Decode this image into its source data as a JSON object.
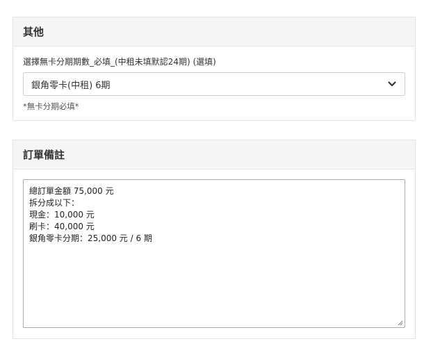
{
  "other_section": {
    "title": "其他",
    "installment_label": "選擇無卡分期期數_必填_(中租未填默認24期) (選填)",
    "installment_selected": "銀角零卡(中租) 6期",
    "help_text": "*無卡分期必填*"
  },
  "notes_section": {
    "title": "訂單備註",
    "lines": [
      "總訂單金額 75,000 元",
      "拆分成以下：",
      "現金：10,000 元",
      "刷卡：40,000 元",
      "銀角零卡分期：25,000 元 / 6 期"
    ]
  },
  "icons": {
    "select_arrow": "chevron-down-icon",
    "textarea_resize": "resize-grip-icon"
  }
}
